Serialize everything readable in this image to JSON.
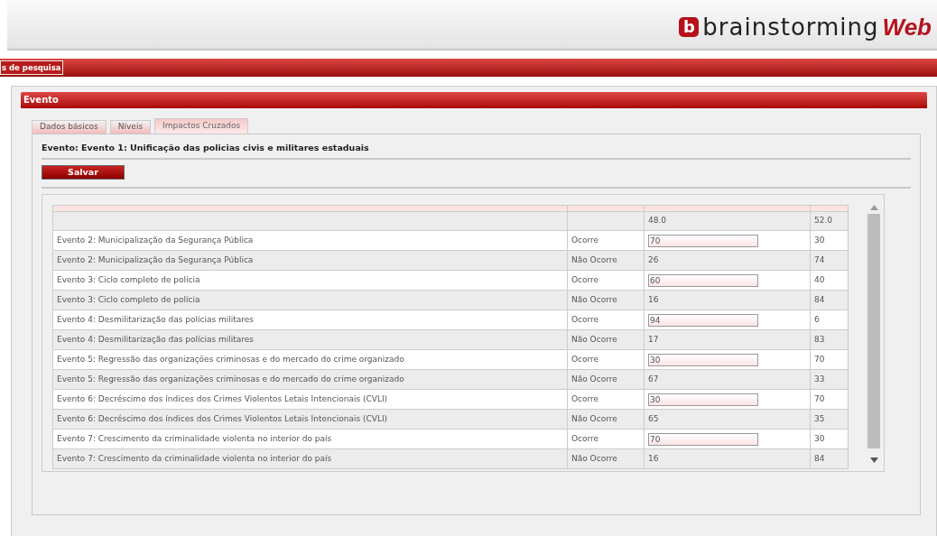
{
  "header": {
    "logo_mark": "b",
    "logo_text": "brainstorming",
    "logo_suffix": "Web"
  },
  "menu_bar": {
    "tabs": [
      {
        "label": "s de pesquisa",
        "selected": true
      }
    ]
  },
  "panel": {
    "title": "Evento",
    "tabs": [
      {
        "label": "Dados básicos",
        "selected": false
      },
      {
        "label": "Níveis",
        "selected": false
      },
      {
        "label": "Impactos Cruzados",
        "selected": true
      }
    ],
    "heading": "Evento: Evento 1: Unificação das policias civis e militares estaduais",
    "save_button": "Salvar",
    "table": {
      "header": {
        "column_3": "48.0",
        "column_4": "52.0"
      },
      "rows": [
        {
          "event": "Evento 2: Municipalização da Segurança Pública",
          "outcome": "Ocorre",
          "kind": "input",
          "value": "70",
          "complement": "30"
        },
        {
          "event": "Evento 2: Municipalização da Segurança Pública",
          "outcome": "Não Ocorre",
          "kind": "text",
          "value": "26",
          "complement": "74"
        },
        {
          "event": "Evento 3: Ciclo completo de polícia",
          "outcome": "Ocorre",
          "kind": "input",
          "value": "60",
          "complement": "40"
        },
        {
          "event": "Evento 3: Ciclo completo de polícia",
          "outcome": "Não Ocorre",
          "kind": "text",
          "value": "16",
          "complement": "84"
        },
        {
          "event": "Evento 4: Desmilitarização das polícias militares",
          "outcome": "Ocorre",
          "kind": "input",
          "value": "94",
          "complement": "6"
        },
        {
          "event": "Evento 4: Desmilitarização das polícias militares",
          "outcome": "Não Ocorre",
          "kind": "text",
          "value": "17",
          "complement": "83"
        },
        {
          "event": "Evento 5: Regressão das organizações criminosas e do mercado do crime organizado",
          "outcome": "Ocorre",
          "kind": "input",
          "value": "30",
          "complement": "70"
        },
        {
          "event": "Evento 5: Regressão das organizações criminosas e do mercado do crime organizado",
          "outcome": "Não Ocorre",
          "kind": "text",
          "value": "67",
          "complement": "33"
        },
        {
          "event": "Evento 6: Decréscimo dos índices dos Crimes Violentos Letais Intencionais (CVLI)",
          "outcome": "Ocorre",
          "kind": "input",
          "value": "30",
          "complement": "70"
        },
        {
          "event": "Evento 6: Decréscimo dos índices dos Crimes Violentos Letais Intencionais (CVLI)",
          "outcome": "Não Ocorre",
          "kind": "text",
          "value": "65",
          "complement": "35"
        },
        {
          "event": "Evento 7: Crescimento da criminalidade violenta no interior do país",
          "outcome": "Ocorre",
          "kind": "input",
          "value": "70",
          "complement": "30"
        },
        {
          "event": "Evento 7: Crescimento da criminalidade violenta no interior do país",
          "outcome": "Não Ocorre",
          "kind": "text",
          "value": "16",
          "complement": "84"
        }
      ]
    }
  }
}
